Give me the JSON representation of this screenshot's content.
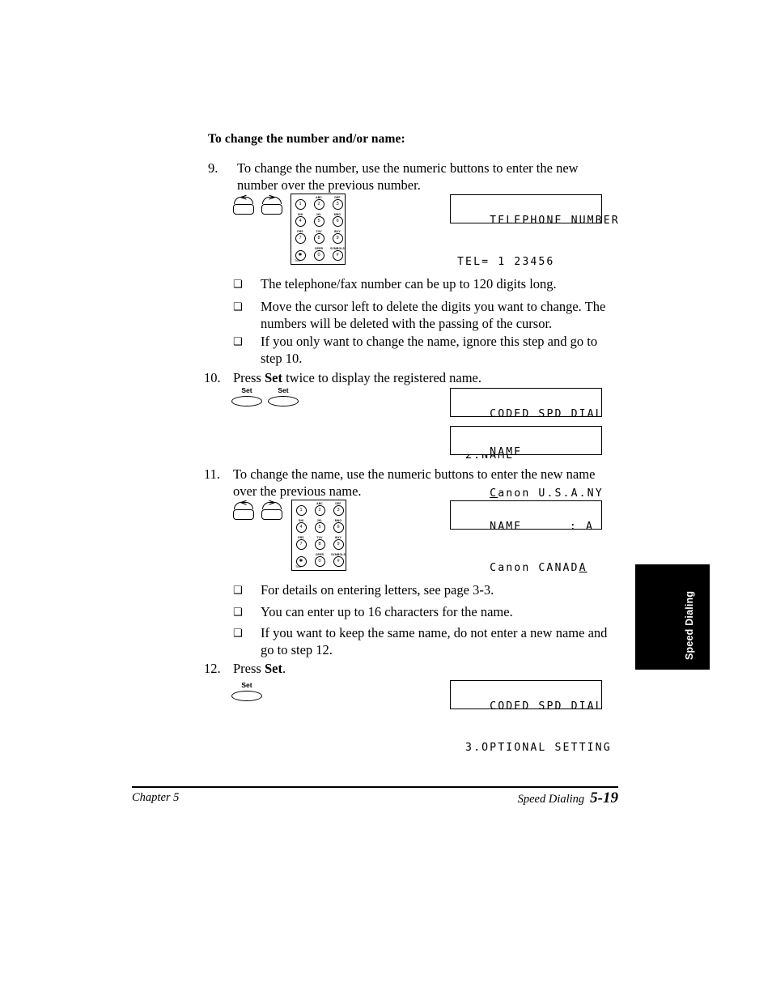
{
  "page": {
    "heading": "To change the number and/or name:",
    "steps": [
      {
        "number": "9.",
        "text_before": "To change the number, use the numeric buttons to enter the new number over the previous number."
      },
      {
        "number": "10.",
        "text_before": "Press ",
        "bold": "Set",
        "text_after": " twice to display the registered name."
      },
      {
        "number": "11.",
        "text_before": "To change the name, use the numeric buttons to enter the new name over the previous name."
      },
      {
        "number": "12.",
        "text_before": "Press ",
        "bold": "Set",
        "text_after": "."
      }
    ],
    "bullets_group_1": [
      "The telephone/fax number can be up to 120 digits long.",
      "Move the cursor left to delete the digits you want to change. The numbers will be deleted with the passing of the cursor.",
      "If you only want to change the name, ignore this step and go to step 10."
    ],
    "bullets_group_2": [
      "For details on entering letters, see page 3-3.",
      "You can enter up to 16 characters for the name.",
      "If you want to keep the same name, do not enter a new name and go to step 12."
    ],
    "bullet_glyph": "❑",
    "lcd_displays": [
      {
        "line1": "TELEPHONE NUMBER",
        "line2": "TEL= 1 23456"
      },
      {
        "line1": "CODED SPD DIAL",
        "line2": " 2.NAME"
      },
      {
        "line1": "NAME",
        "line2": "    Canon U.S.A.NY",
        "cursor_char": "C"
      },
      {
        "line1": "NAME",
        "line2": "    Canon CANADA",
        "right_label": ": A",
        "cursor_char": "A"
      },
      {
        "line1": "CODED SPD DIAL",
        "line2": " 3.OPTIONAL SETTING"
      }
    ],
    "cursor_buttons": {
      "left_glyph": "<",
      "right_glyph": ">"
    },
    "set_button_label": "Set",
    "keypad": {
      "keys": [
        {
          "digit": "1",
          "letters": ""
        },
        {
          "digit": "2",
          "letters": "ABC"
        },
        {
          "digit": "3",
          "letters": "DEF"
        },
        {
          "digit": "4",
          "letters": "GHI"
        },
        {
          "digit": "5",
          "letters": "JKL"
        },
        {
          "digit": "6",
          "letters": "MNO"
        },
        {
          "digit": "7",
          "letters": "PRS"
        },
        {
          "digit": "8",
          "letters": "TUV"
        },
        {
          "digit": "9",
          "letters": "WXY"
        },
        {
          "digit": "✱",
          "letters": ""
        },
        {
          "digit": "0",
          "letters": "OPER"
        },
        {
          "digit": "#",
          "letters": "SYMBOLS"
        }
      ],
      "tone_label": "Tone"
    },
    "side_tab": {
      "label": "Speed Dialing",
      "background": "#000000",
      "text_color": "#ffffff"
    },
    "footer": {
      "left": "Chapter 5",
      "right": "Speed Dialing",
      "page_number": "5-19"
    }
  }
}
